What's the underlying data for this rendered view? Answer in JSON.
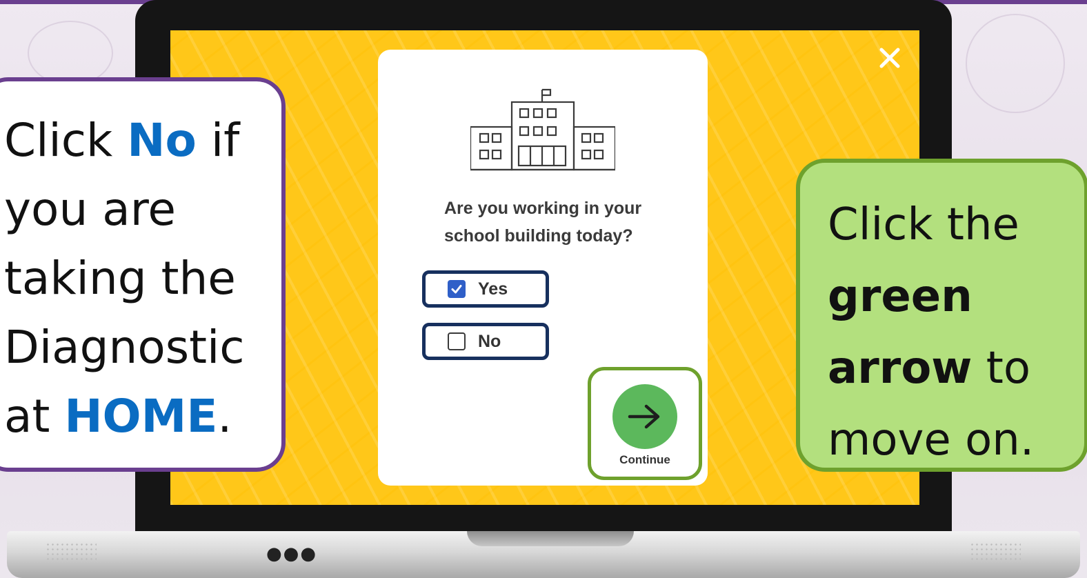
{
  "modal": {
    "question": "Are you working in your school building today?",
    "options": [
      {
        "label": "Yes",
        "checked": true
      },
      {
        "label": "No",
        "checked": false
      }
    ],
    "continue_label": "Continue",
    "close_icon": "close-icon",
    "illustration_icon": "school-building-icon",
    "accent_color": "#5cb85c"
  },
  "callout_left": {
    "line1_a": "Click ",
    "line1_b": "No",
    "line1_c": " if",
    "line2": "you are",
    "line3": "taking the",
    "line4": "Diagnostic",
    "line5_a": "at ",
    "line5_b": "HOME",
    "line5_c": ".",
    "border_color": "#6a3f8f",
    "highlight_color": "#0a6cc2"
  },
  "callout_right": {
    "line1": "Click the",
    "line2": "green",
    "line3_a": "arrow",
    "line3_b": " to",
    "line4": "move on.",
    "background_color": "#b3e07e",
    "border_color": "#6ea12d"
  },
  "laptop": {
    "screen_color": "#ffc719"
  }
}
